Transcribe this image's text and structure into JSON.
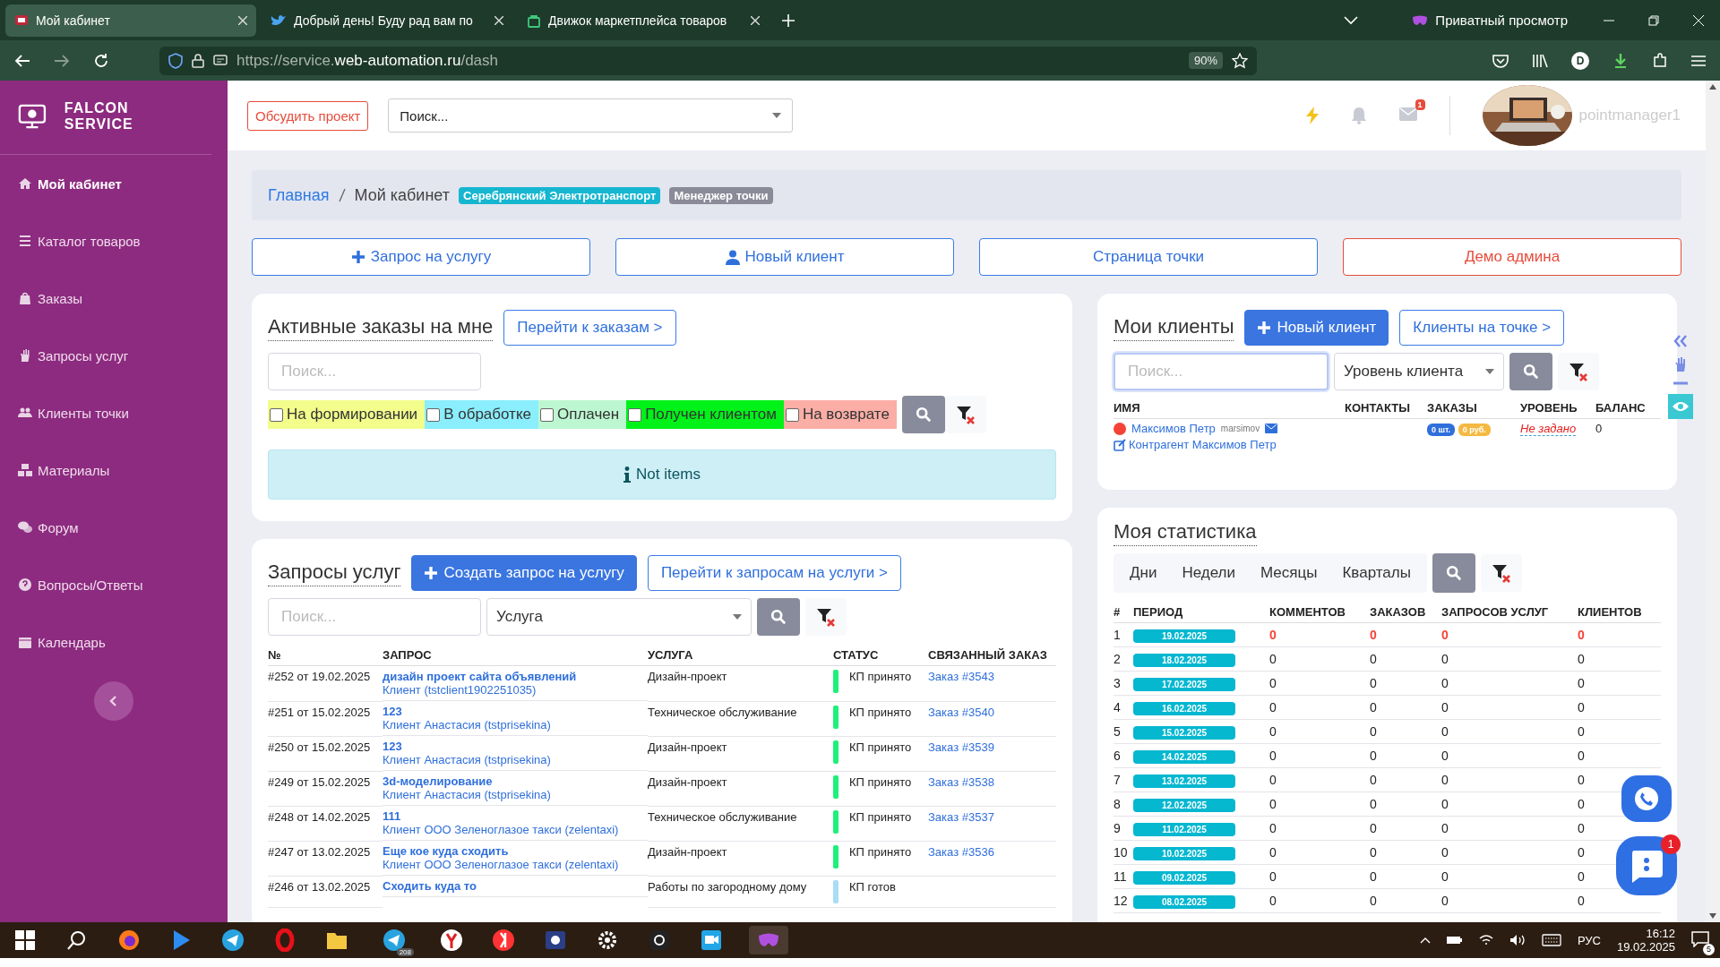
{
  "browser": {
    "tabs": [
      {
        "title": "Мой кабинет",
        "selected": true
      },
      {
        "title": "Добрый день! Буду рад вам по",
        "selected": false
      },
      {
        "title": "Движок маркетплейса товаров",
        "selected": false
      }
    ],
    "private_label": "Приватный просмотр",
    "url": {
      "prefix": "https://service.",
      "domain": "web-automation.ru",
      "path": "/dash"
    },
    "zoom": "90%",
    "profile_letter": "D"
  },
  "sidebar": {
    "brand": "FALCON SERVICE",
    "items": [
      {
        "label": "Мой кабинет",
        "selected": true
      },
      {
        "label": "Каталог товаров",
        "selected": false
      },
      {
        "label": "Заказы",
        "selected": false
      },
      {
        "label": "Запросы услуг",
        "selected": false
      },
      {
        "label": "Клиенты точки",
        "selected": false
      },
      {
        "label": "Материалы",
        "selected": false
      },
      {
        "label": "Форум",
        "selected": false
      },
      {
        "label": "Вопросы/Ответы",
        "selected": false
      },
      {
        "label": "Календарь",
        "selected": false
      }
    ]
  },
  "header": {
    "discuss_button": "Обсудить проект",
    "search": "Поиск...",
    "mail_badge": "1",
    "username": "pointmanager1"
  },
  "breadcrumb": {
    "items": [
      "Главная",
      "Мой кабинет"
    ],
    "badges": [
      {
        "text": "Серебрянский Электротранспорт",
        "color": "#17b6d0"
      },
      {
        "text": "Менеджер точки",
        "color": "#8a8a98"
      }
    ]
  },
  "actions": [
    {
      "label": "Запрос на услугу",
      "kind": "plus"
    },
    {
      "label": "Новый клиент",
      "kind": "user"
    },
    {
      "label": "Страница точки",
      "kind": "plain"
    },
    {
      "label": "Демо админа",
      "kind": "danger"
    }
  ],
  "orders": {
    "title": "Активные заказы на мне",
    "link": "Перейти к заказам >",
    "search": {
      "placeholder": "Поиск..."
    },
    "filters": [
      {
        "label": "На формировании",
        "checked": false,
        "color": "#f2fd8c"
      },
      {
        "label": "В обработке",
        "checked": false,
        "color": "#8aeefd"
      },
      {
        "label": "Оплачен",
        "checked": false,
        "color": "#bdf7d1"
      },
      {
        "label": "Получен клиентом",
        "checked": false,
        "color": "#00f218"
      },
      {
        "label": "На возврате",
        "checked": false,
        "color": "#fbaea6"
      }
    ],
    "empty_message": "Not items"
  },
  "requests": {
    "title": "Запросы услуг",
    "create_button": "Создать запрос на услугу",
    "link": "Перейти к запросам на услуги >",
    "search": {
      "placeholder": "Поиск..."
    },
    "service_select": "Услуга",
    "columns": [
      "№",
      "ЗАПРОС",
      "УСЛУГА",
      "СТАТУС",
      "СВЯЗАННЫЙ ЗАКАЗ"
    ],
    "rows": [
      {
        "number": "#252 от 19.02.2025",
        "request": "дизайн проект сайта объявлений",
        "client": "Клиент (tstclient1902251035)",
        "service": "Дизайн-проект",
        "status": "КП принято",
        "color": "#1ef07a",
        "order": "Заказ #3543"
      },
      {
        "number": "#251 от 15.02.2025",
        "request": "123",
        "client": "Клиент Анастасия (tstprisekina)",
        "service": "Техническое обслуживание",
        "status": "КП принято",
        "color": "#1ef07a",
        "order": "Заказ #3540"
      },
      {
        "number": "#250 от 15.02.2025",
        "request": "123",
        "client": "Клиент Анастасия (tstprisekina)",
        "service": "Дизайн-проект",
        "status": "КП принято",
        "color": "#1ef07a",
        "order": "Заказ #3539"
      },
      {
        "number": "#249 от 15.02.2025",
        "request": "3d-моделирование",
        "client": "Клиент Анастасия (tstprisekina)",
        "service": "Дизайн-проект",
        "status": "КП принято",
        "color": "#1ef07a",
        "order": "Заказ #3538"
      },
      {
        "number": "#248 от 14.02.2025",
        "request": "111",
        "client": "Клиент ООО Зеленоглазое такси (zelentaxi)",
        "service": "Техническое обслуживание",
        "status": "КП принято",
        "color": "#1ef07a",
        "order": "Заказ #3537"
      },
      {
        "number": "#247 от 13.02.2025",
        "request": "Еще кое куда сходить",
        "client": "Клиент ООО Зеленоглазое такси (zelentaxi)",
        "service": "Дизайн-проект",
        "status": "КП принято",
        "color": "#1ef07a",
        "order": "Заказ #3536"
      },
      {
        "number": "#246 от 13.02.2025",
        "request": "Сходить куда то",
        "service": "Работы по загородному дому",
        "status": "КП готов",
        "color": "#a9dcf5"
      }
    ]
  },
  "clients": {
    "title": "Мои клиенты",
    "new_button": "Новый клиент",
    "link": "Клиенты на точке >",
    "search": {
      "placeholder": "Поиск..."
    },
    "level_select": "Уровень клиента",
    "columns": [
      "ИМЯ",
      "КОНТАКТЫ",
      "ЗАКАЗЫ",
      "УРОВЕНЬ",
      "БАЛАНС"
    ],
    "rows": [
      {
        "name": "Максимов Петр",
        "login": "marsimov",
        "color": "#f44336",
        "contractor": "Контрагент Максимов Петр",
        "orders_count": "0 шт.",
        "orders_sum": "0 руб.",
        "level": "Не задано",
        "balance": "0"
      }
    ]
  },
  "stats": {
    "title": "Моя статистика",
    "tabs": [
      "Дни",
      "Недели",
      "Месяцы",
      "Кварталы"
    ],
    "columns": [
      "#",
      "ПЕРИОД",
      "КОММЕНТОВ",
      "ЗАКАЗОВ",
      "ЗАПРОСОВ УСЛУГ",
      "КЛИЕНТОВ"
    ],
    "rows": [
      {
        "n": "1",
        "period": "19.02.2025",
        "values": [
          "0",
          "0",
          "0",
          "0"
        ],
        "highlight": true
      },
      {
        "n": "2",
        "period": "18.02.2025",
        "values": [
          "0",
          "0",
          "0",
          "0"
        ],
        "highlight": false
      },
      {
        "n": "3",
        "period": "17.02.2025",
        "values": [
          "0",
          "0",
          "0",
          "0"
        ],
        "highlight": false
      },
      {
        "n": "4",
        "period": "16.02.2025",
        "values": [
          "0",
          "0",
          "0",
          "0"
        ],
        "highlight": false
      },
      {
        "n": "5",
        "period": "15.02.2025",
        "values": [
          "0",
          "0",
          "0",
          "0"
        ],
        "highlight": false
      },
      {
        "n": "6",
        "period": "14.02.2025",
        "values": [
          "0",
          "0",
          "0",
          "0"
        ],
        "highlight": false
      },
      {
        "n": "7",
        "period": "13.02.2025",
        "values": [
          "0",
          "0",
          "0",
          "0"
        ],
        "highlight": false
      },
      {
        "n": "8",
        "period": "12.02.2025",
        "values": [
          "0",
          "0",
          "0",
          "0"
        ],
        "highlight": false
      },
      {
        "n": "9",
        "period": "11.02.2025",
        "values": [
          "0",
          "0",
          "0",
          "0"
        ],
        "highlight": false
      },
      {
        "n": "10",
        "period": "10.02.2025",
        "values": [
          "0",
          "0",
          "0",
          "0"
        ],
        "highlight": false
      },
      {
        "n": "11",
        "period": "09.02.2025",
        "values": [
          "0",
          "0",
          "0",
          "0"
        ],
        "highlight": false
      },
      {
        "n": "12",
        "period": "08.02.2025",
        "values": [
          "0",
          "0",
          "0",
          "0"
        ],
        "highlight": false
      }
    ]
  },
  "chat": {
    "badge": "1"
  },
  "taskbar": {
    "telegram_badge": "208",
    "language": "РУС",
    "time": "16:12",
    "date": "19.02.2025",
    "notifications": "5"
  }
}
